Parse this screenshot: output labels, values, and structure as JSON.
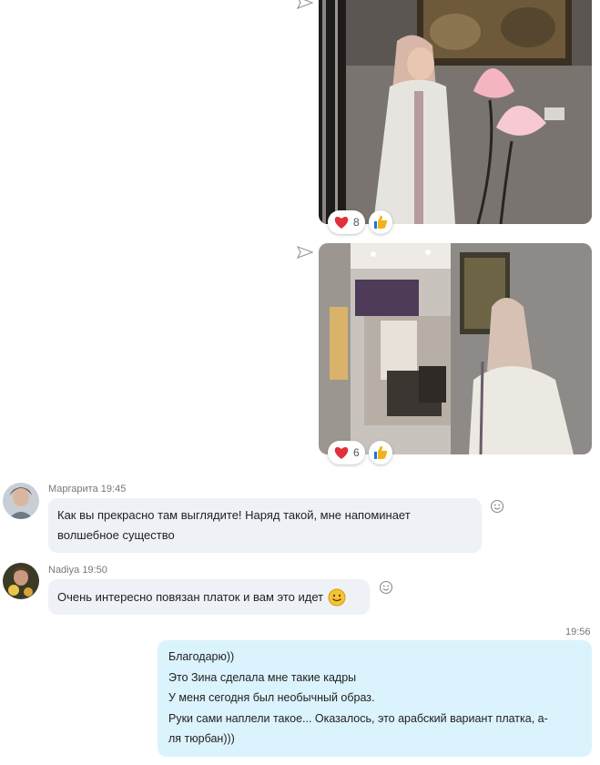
{
  "messages": {
    "photo1": {
      "reactions": {
        "heart_count": "8"
      }
    },
    "photo2": {
      "reactions": {
        "heart_count": "6"
      }
    },
    "msg1": {
      "author": "Маргарита",
      "time": "19:45",
      "line1": "Как вы прекрасно там выглядите! Наряд такой, мне напоминает",
      "line2": "волшебное существо"
    },
    "msg2": {
      "author": "Nadiya",
      "time": "19:50",
      "text": "Очень интересно повязан платок и вам это идет"
    },
    "msg3": {
      "time": "19:56",
      "lines": [
        "Благодарю))",
        "Это Зина сделала мне такие кадры",
        "У меня сегодня был необычный образ.",
        "Руки сами наплели такое... Оказалось, это арабский вариант платка, а-",
        "ля тюрбан)))"
      ]
    }
  },
  "icons": {
    "sent": "paper-plane-icon",
    "heart": "heart-icon",
    "thumbs_up": "thumbs-up-icon",
    "smile": "smile-icon",
    "emoji": "smiling-face-emoji"
  },
  "colors": {
    "bubble_incoming": "#eef1f5",
    "bubble_outgoing": "#dbf3fd",
    "heart": "#e0303a",
    "thumb": "#f2b21b"
  }
}
